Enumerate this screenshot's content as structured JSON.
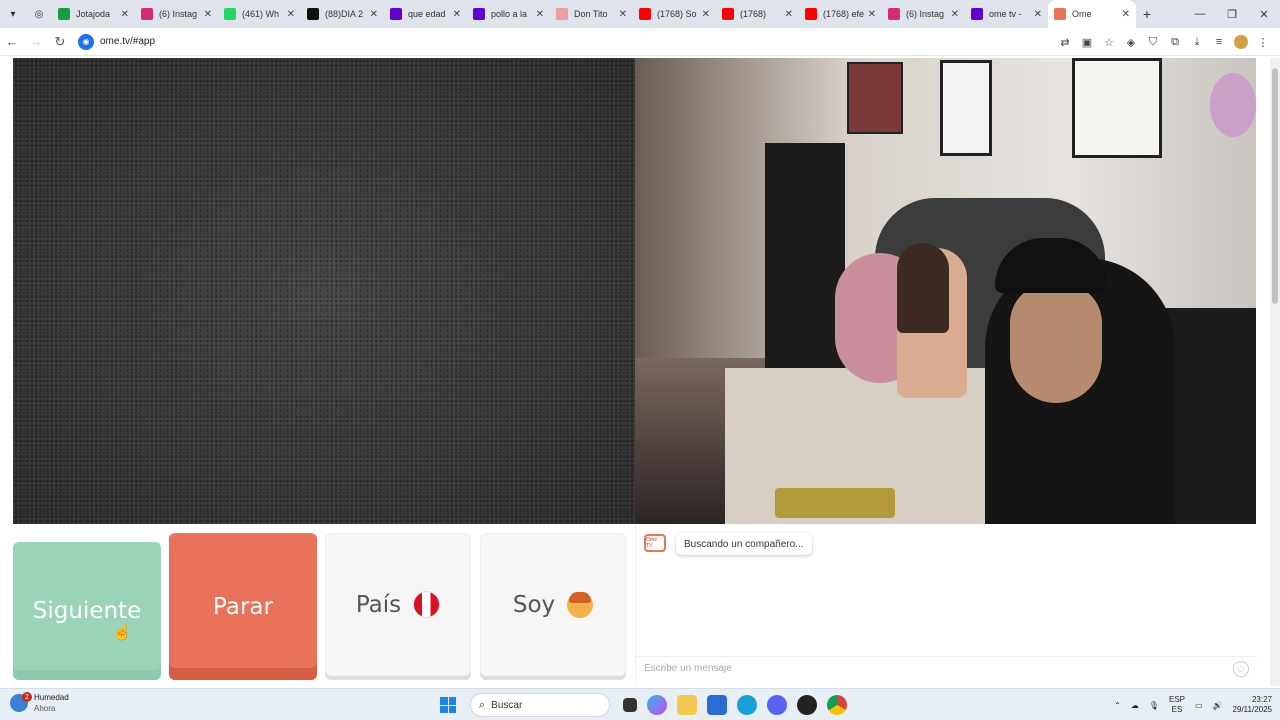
{
  "browser": {
    "tabs": [
      {
        "title": "Jotajoda",
        "color": "#1a9c3e"
      },
      {
        "title": "(6) Instag",
        "color": "#d62976"
      },
      {
        "title": "(461) Wh",
        "color": "#25d366"
      },
      {
        "title": "(88)DIA 2",
        "color": "#111111"
      },
      {
        "title": "que edad",
        "color": "#6001d2"
      },
      {
        "title": "pollo a la",
        "color": "#6001d2"
      },
      {
        "title": "Don Tito",
        "color": "#e9a0a0"
      },
      {
        "title": "(1768) So",
        "color": "#ff0000"
      },
      {
        "title": "(1768)",
        "color": "#ff0000"
      },
      {
        "title": "(1768) efe",
        "color": "#ff0000"
      },
      {
        "title": "(6) Instag",
        "color": "#d62976"
      },
      {
        "title": "ome tv -",
        "color": "#6001d2"
      },
      {
        "title": "Ome",
        "color": "#e9725b",
        "active": true
      }
    ],
    "url": "ome.tv/#app"
  },
  "controls": {
    "next_label": "Siguiente",
    "stop_label": "Parar",
    "country_label": "País",
    "gender_label": "Soy"
  },
  "chat": {
    "status": "Buscando un compañero...",
    "input_placeholder": "Escribe un mensaje",
    "logo_text": "Ome TV"
  },
  "taskbar": {
    "weather_title": "Humedad",
    "weather_sub": "Ahora",
    "weather_badge": "2",
    "search_label": "Buscar",
    "lang_top": "ESP",
    "lang_bottom": "ES",
    "time": "23:27",
    "date": "29/11/2025"
  }
}
